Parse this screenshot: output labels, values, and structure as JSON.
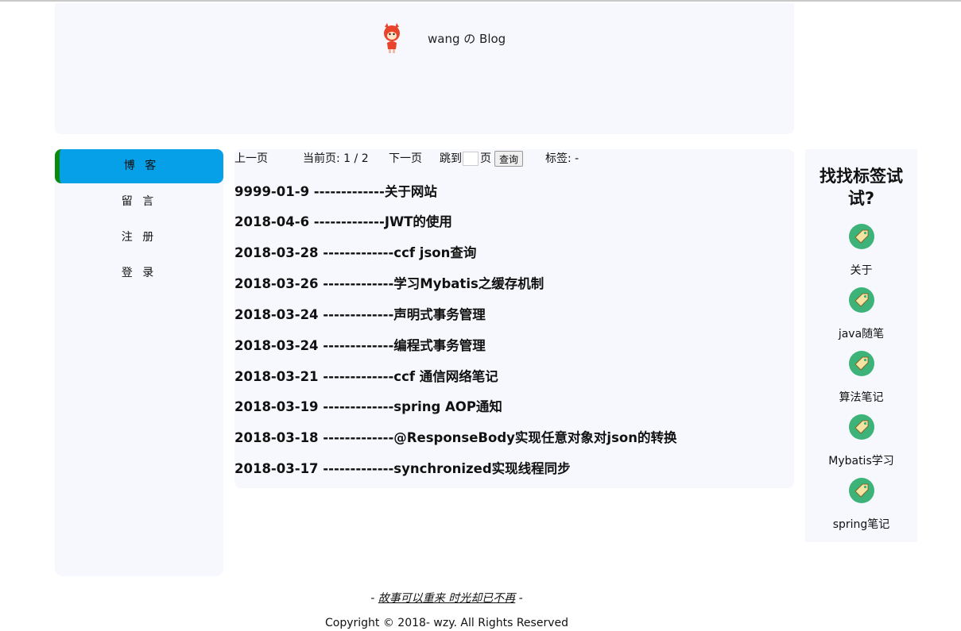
{
  "header": {
    "site_title": "wang の Blog",
    "logo": "fox-mascot"
  },
  "nav": {
    "items": [
      {
        "label": "博 客",
        "active": true
      },
      {
        "label": "留 言"
      },
      {
        "label": "注 册"
      },
      {
        "label": "登 录"
      }
    ],
    "active_color": "#05a0e8",
    "active_border_color": "#0a8a0a"
  },
  "pager": {
    "prev": "上一页",
    "current_label": "当前页: 1 / 2",
    "next": "下一页",
    "jump_to": "跳到",
    "page_unit": "页",
    "page_input_value": "",
    "query_button": "查询",
    "tag_label": "标签: -"
  },
  "posts": [
    {
      "text": "9999-01-9 -------------关于网站"
    },
    {
      "text": "2018-04-6 -------------JWT的使用"
    },
    {
      "text": "2018-03-28 -------------ccf json查询"
    },
    {
      "text": "2018-03-26 -------------学习Mybatis之缓存机制"
    },
    {
      "text": "2018-03-24 -------------声明式事务管理"
    },
    {
      "text": "2018-03-24 -------------编程式事务管理"
    },
    {
      "text": "2018-03-21 -------------ccf 通信网络笔记"
    },
    {
      "text": "2018-03-19 -------------spring AOP通知"
    },
    {
      "text": "2018-03-18 -------------@ResponseBody实现任意对象对json的转换"
    },
    {
      "text": "2018-03-17 -------------synchronized实现线程同步"
    }
  ],
  "tags_panel": {
    "title": "找找标签试试?",
    "icon": "tag-icon",
    "tags": [
      {
        "label": "关于"
      },
      {
        "label": "java随笔"
      },
      {
        "label": "算法笔记"
      },
      {
        "label": "Mybatis学习"
      },
      {
        "label": "spring笔记"
      }
    ]
  },
  "footer": {
    "motto_prefix": "- ",
    "motto": "故事可以重来 时光却已不再",
    "motto_suffix": " -",
    "copyright": "Copyright © 2018-  wzy. All Rights Reserved"
  }
}
